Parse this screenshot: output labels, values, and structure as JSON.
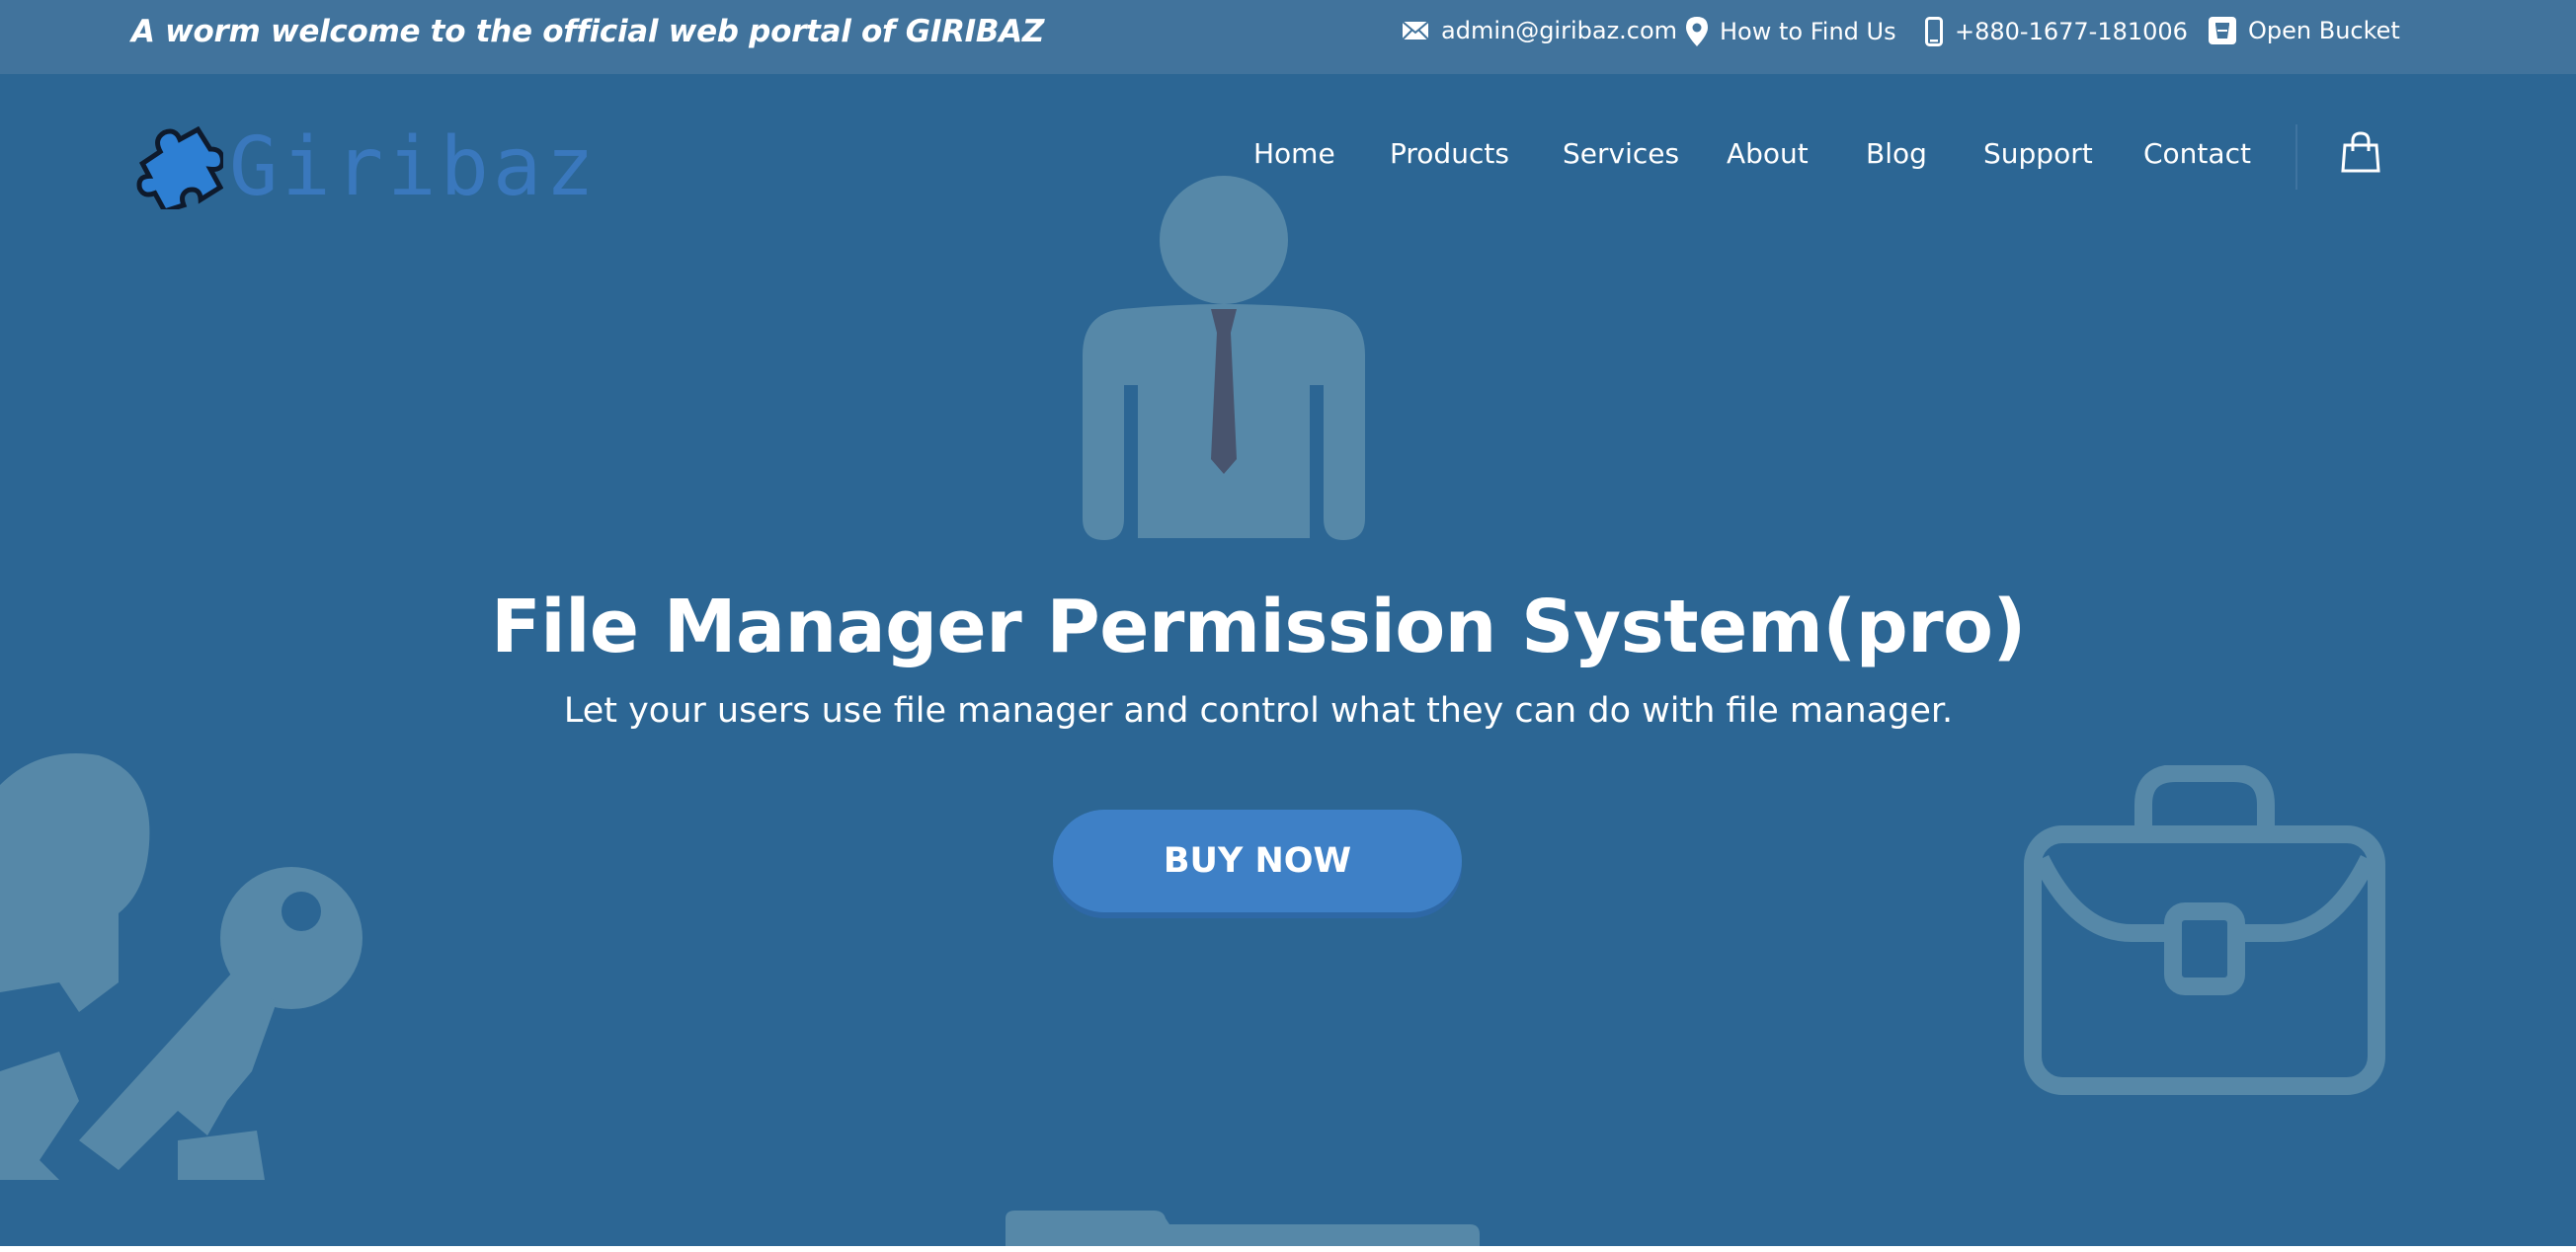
{
  "topbar": {
    "welcome": "A worm welcome to the official web portal of GIRIBAZ",
    "email": "admin@giribaz.com",
    "find_us": "How to Find Us",
    "phone": "+880-1677-181006",
    "open_bucket": "Open Bucket"
  },
  "brand": {
    "name": "Giribaz"
  },
  "nav": [
    "Home",
    "Products",
    "Services",
    "About",
    "Blog",
    "Support",
    "Contact"
  ],
  "hero": {
    "title": "File Manager Permission System(pro)",
    "subtitle": "Let your users use file manager and control what they can do with file manager.",
    "cta": "BUY NOW"
  },
  "icons": [
    "mail-icon",
    "location-pin-icon",
    "phone-icon",
    "bucket-icon",
    "puzzle-icon",
    "shopping-bag-icon",
    "businessman-icon",
    "keys-icon",
    "briefcase-icon",
    "folder-icon"
  ],
  "colors": {
    "hero_bg": "#2c6694",
    "topbar_bg": "#41739c",
    "brand_blue": "#3a78bd",
    "button": "#3e80c6",
    "figure": "#5688a8"
  }
}
